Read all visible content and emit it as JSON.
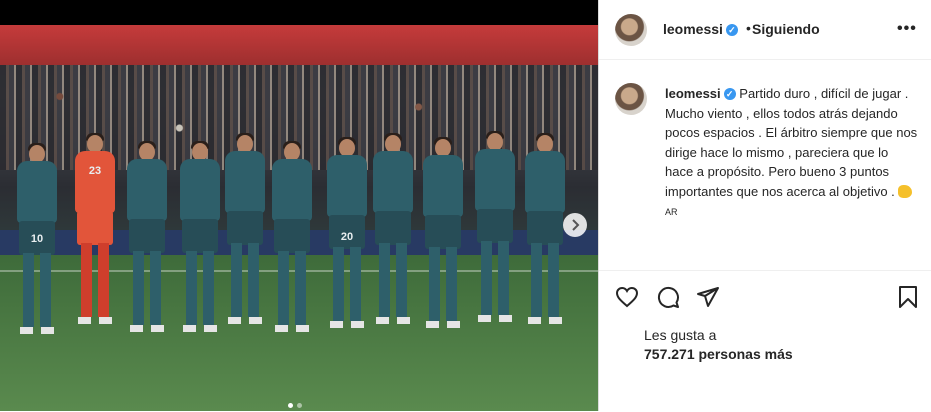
{
  "post_image": {
    "jersey_numbers": [
      "10",
      "23",
      "",
      "",
      "",
      "",
      "20",
      "",
      "",
      "",
      ""
    ],
    "carousel_dots": 2,
    "active_dot": 0
  },
  "header": {
    "username": "leomessi",
    "verified_icon": "verified-badge-icon",
    "separator": "•",
    "follow_status": "Siguiendo",
    "more_icon": "•••"
  },
  "caption": {
    "username": "leomessi",
    "text": "Partido duro , difícil de jugar . Mucho viento , ellos todos atrás dejando pocos espacios . El árbitro siempre que nos dirige hace lo mismo , pareciera que lo hace a propósito. Pero bueno 3 puntos importantes que nos acerca al objetivo .",
    "emoji": "flexed-biceps-icon",
    "flag_text": "AR"
  },
  "actions": {
    "like_icon": "heart-icon",
    "comment_icon": "comment-icon",
    "share_icon": "share-icon",
    "save_icon": "bookmark-icon"
  },
  "likes": {
    "liked_by_prefix": "Les gusta a",
    "count_text": "757.271 personas más"
  },
  "colors": {
    "verified_blue": "#3897f0",
    "text": "#262626"
  }
}
